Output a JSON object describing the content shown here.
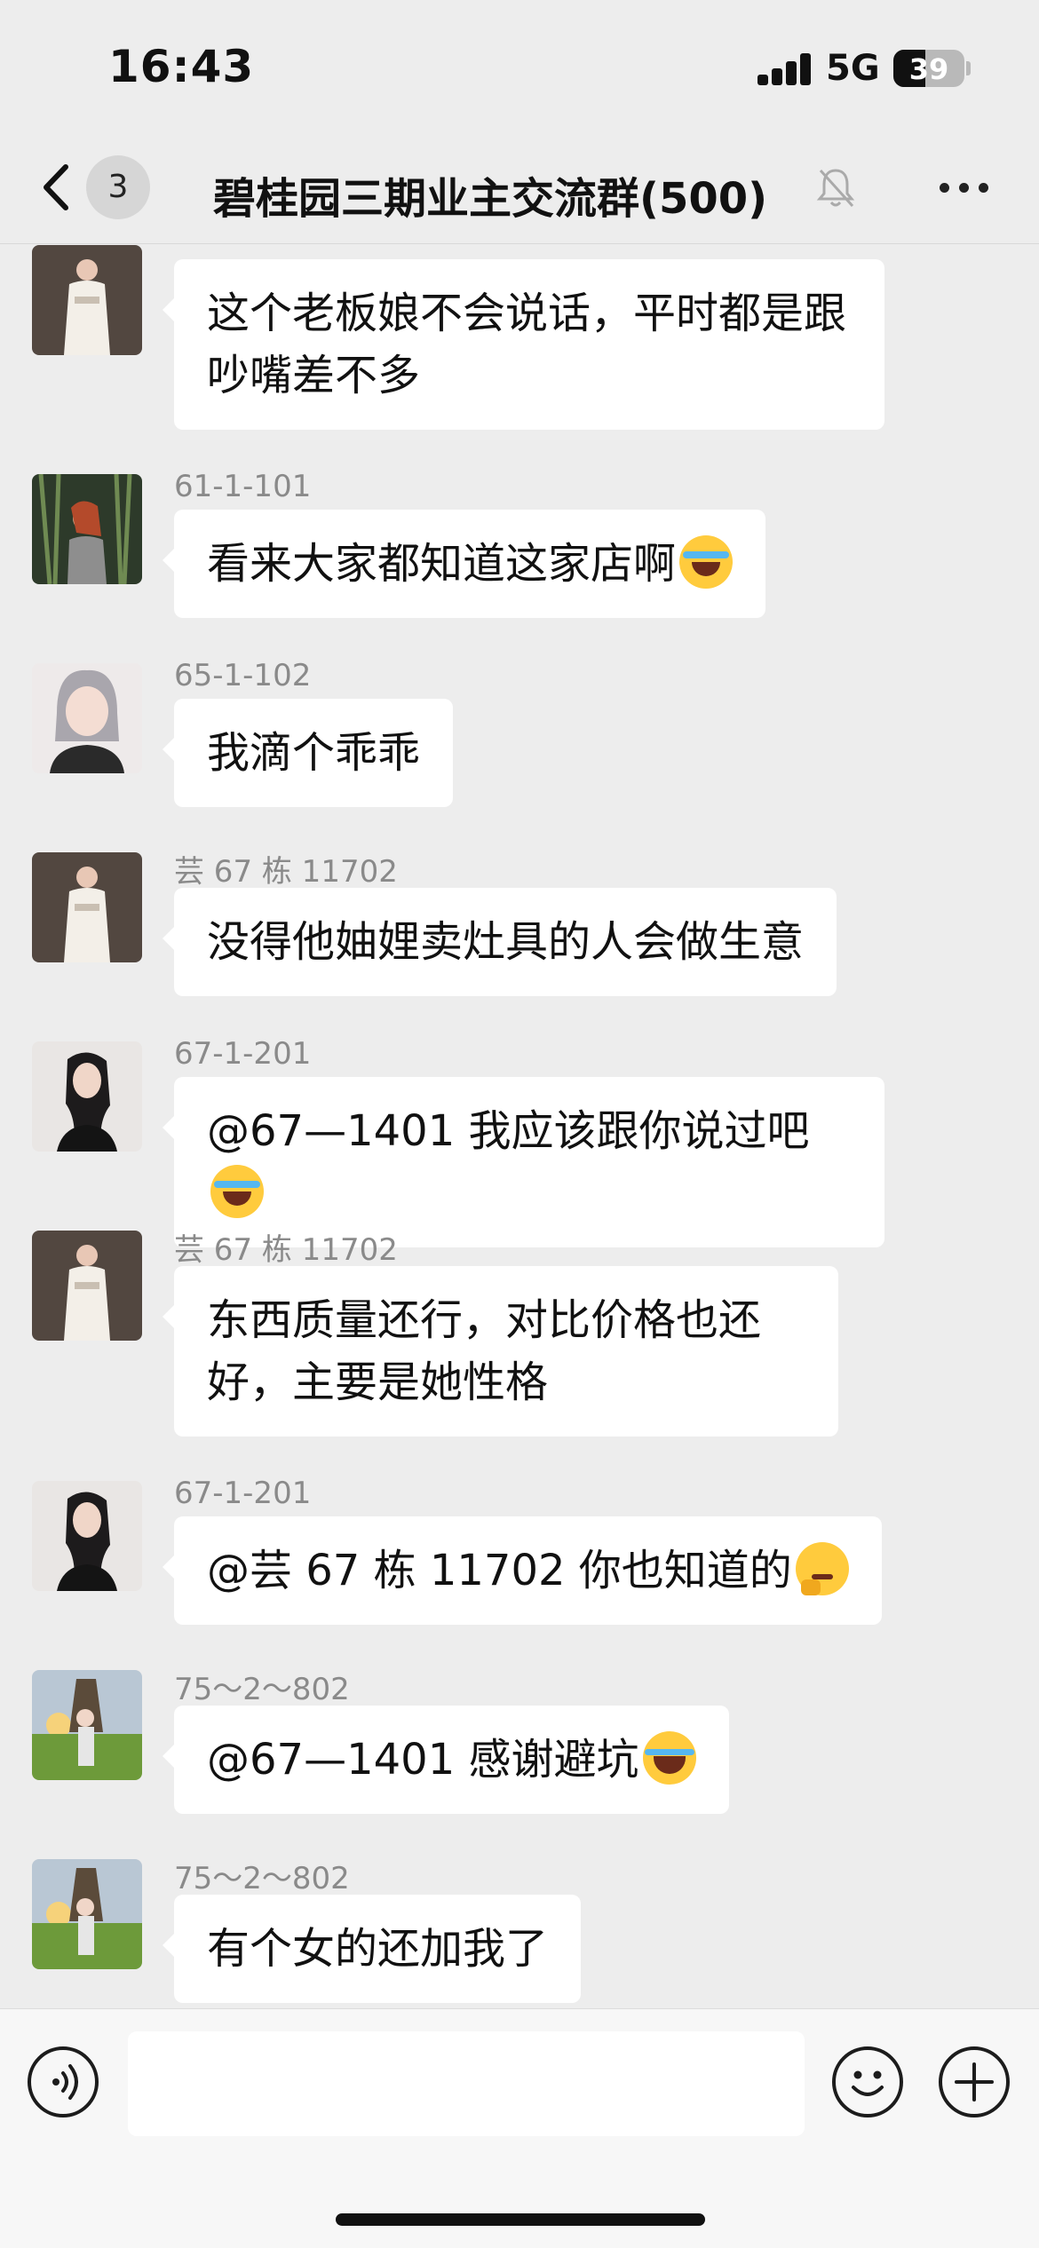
{
  "status_bar": {
    "time": "16:43",
    "network": "5G",
    "battery": "39"
  },
  "nav": {
    "unread_count": "3",
    "title": "碧桂园三期业主交流群(500)"
  },
  "messages": [
    {
      "sender": "",
      "text": "这个老板娘不会说话，平时都是跟吵嘴差不多",
      "emoji": "",
      "avatar": "white-dress"
    },
    {
      "sender": "61-1-101",
      "text": "看来大家都知道这家店啊",
      "emoji": "loudly-crying-face",
      "avatar": "plants"
    },
    {
      "sender": "65-1-102",
      "text": "我滴个乖乖",
      "emoji": "",
      "avatar": "anime-girl"
    },
    {
      "sender": "芸 67 栋 11702",
      "text": "没得他妯娌卖灶具的人会做生意",
      "emoji": "",
      "avatar": "white-dress"
    },
    {
      "sender": "67-1-201",
      "text": "@67—1401 我应该跟你说过吧",
      "emoji": "loudly-crying-face",
      "avatar": "dark-hair"
    },
    {
      "sender": "芸 67 栋 11702",
      "text": "东西质量还行，对比价格也还好，主要是她性格",
      "emoji": "",
      "avatar": "white-dress"
    },
    {
      "sender": "67-1-201",
      "text": "@芸 67 栋 11702 你也知道的",
      "emoji": "thinking-face",
      "avatar": "dark-hair"
    },
    {
      "sender": "75～2～802",
      "text": "@67—1401 感谢避坑",
      "emoji": "tears-of-joy-face",
      "avatar": "sunset-field"
    },
    {
      "sender": "75～2～802",
      "text": "有个女的还加我了",
      "emoji": "",
      "avatar": "sunset-field"
    }
  ],
  "input_bar": {
    "placeholder": ""
  }
}
